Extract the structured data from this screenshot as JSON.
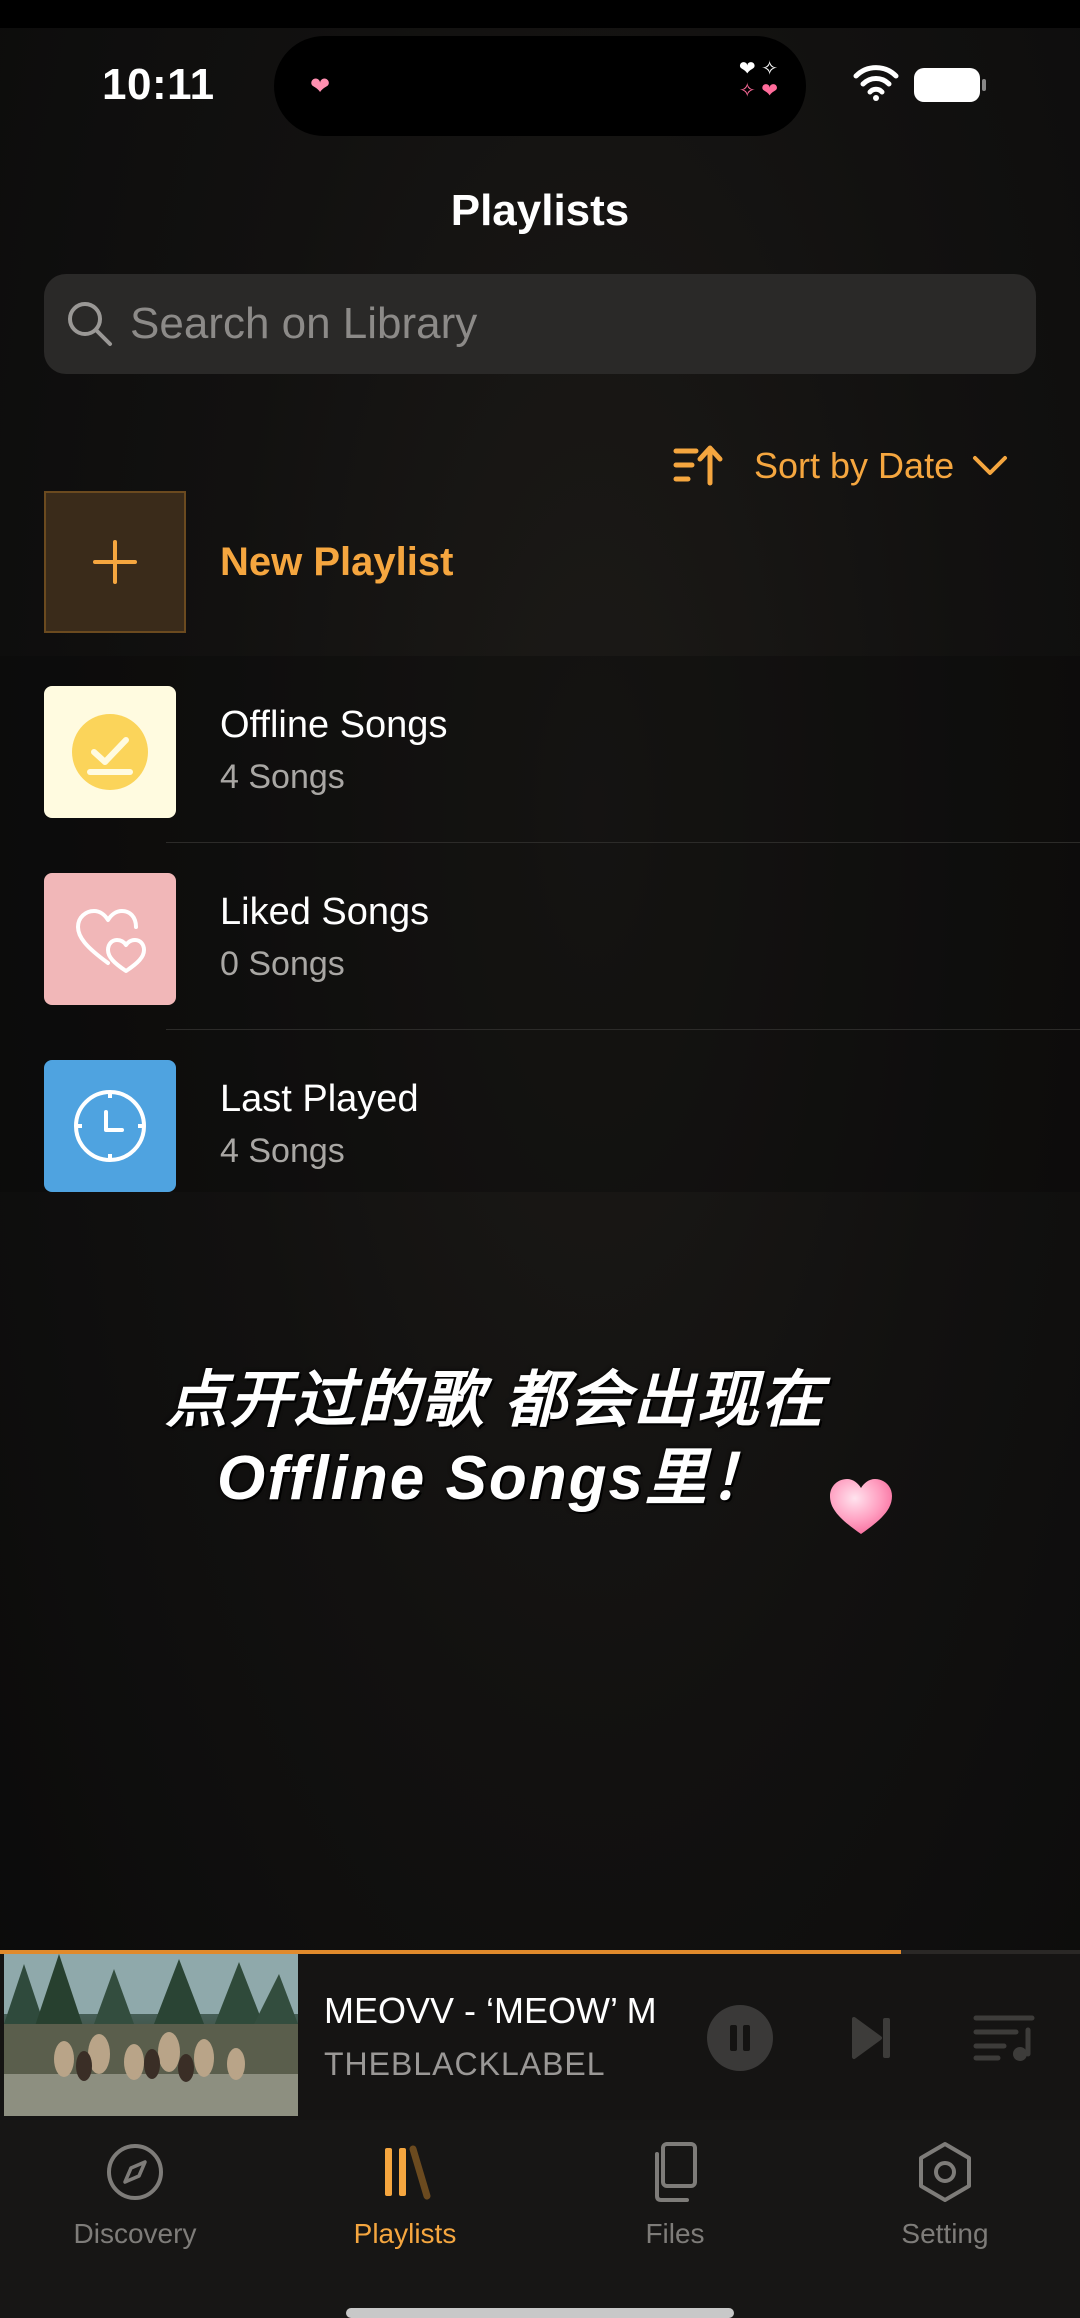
{
  "status_bar": {
    "time": "10:11",
    "island_heart": "❤",
    "island_sparkle_top": "❤ ✧",
    "island_sparkle_bottom": "✧ ❤"
  },
  "header": {
    "title": "Playlists"
  },
  "search": {
    "placeholder": "Search on Library",
    "value": ""
  },
  "sort": {
    "label": "Sort by Date"
  },
  "new_playlist": {
    "label": "New Playlist"
  },
  "playlists": [
    {
      "title": "Offline Songs",
      "count": "4 Songs",
      "color": "#fffbe0",
      "icon": "check-badge-icon"
    },
    {
      "title": "Liked Songs",
      "count": "0 Songs",
      "color": "#f1b7b8",
      "icon": "hearts-icon"
    },
    {
      "title": "Last Played",
      "count": "4 Songs",
      "color": "#4fa3e0",
      "icon": "clock-icon"
    }
  ],
  "overlay": {
    "line1": "点开过的歌 都会出现在",
    "line2": "Offline  Songs里！"
  },
  "player": {
    "title": "MEOVV - ‘MEOW’ M",
    "artist": "THEBLACKLABEL",
    "progress": 0.834
  },
  "tabs": [
    {
      "label": "Discovery",
      "icon": "compass-icon",
      "active": false
    },
    {
      "label": "Playlists",
      "icon": "library-icon",
      "active": true
    },
    {
      "label": "Files",
      "icon": "files-icon",
      "active": false
    },
    {
      "label": "Setting",
      "icon": "gear-icon",
      "active": false
    }
  ],
  "colors": {
    "accent": "#f5a63f",
    "background": "#111010",
    "progress": "#e18a2c"
  }
}
